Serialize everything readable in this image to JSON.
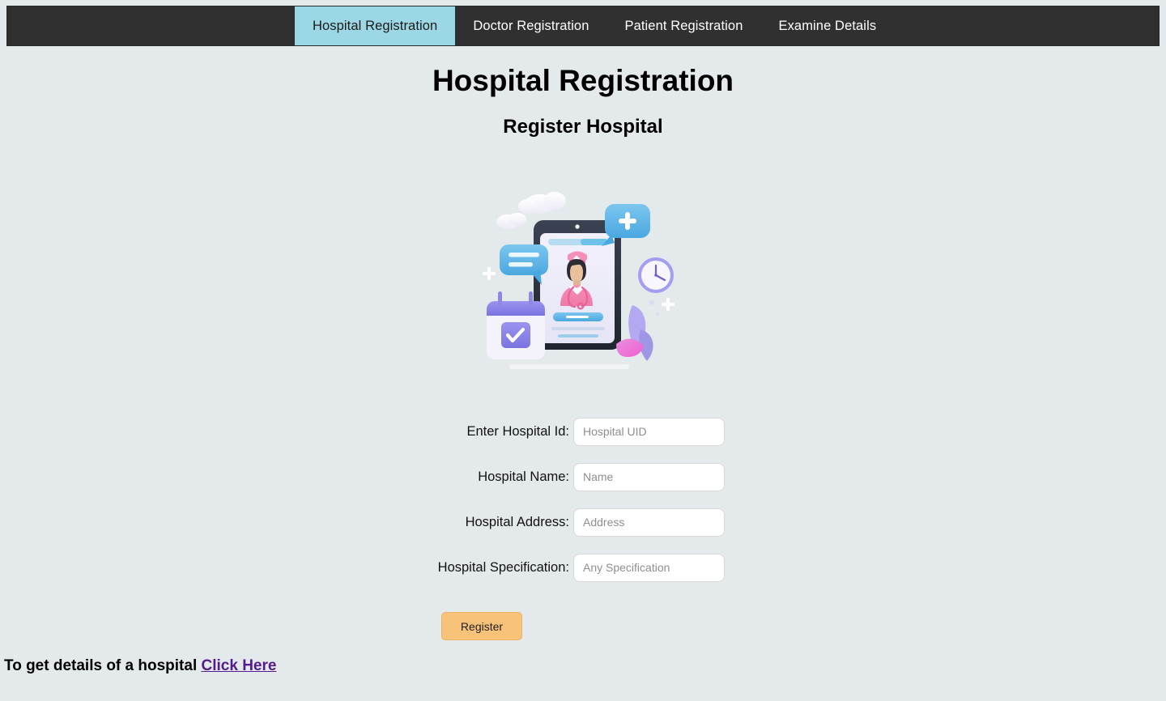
{
  "nav": {
    "tabs": [
      {
        "label": "Hospital Registration",
        "active": true
      },
      {
        "label": "Doctor Registration",
        "active": false
      },
      {
        "label": "Patient Registration",
        "active": false
      },
      {
        "label": "Examine Details",
        "active": false
      }
    ],
    "background_color": "#303030",
    "active_tab_color": "#9bd7e4"
  },
  "header": {
    "title": "Hospital Registration",
    "subtitle": "Register Hospital"
  },
  "illustration": {
    "name": "medical-appointment-illustration",
    "alt": "Tablet showing a nurse profile with chat bubbles, calendar and clock"
  },
  "form": {
    "fields": [
      {
        "label": "Enter Hospital Id:",
        "placeholder": "Hospital UID",
        "value": "",
        "name": "hospital-id-input"
      },
      {
        "label": "Hospital Name:",
        "placeholder": "Name",
        "value": "",
        "name": "hospital-name-input"
      },
      {
        "label": "Hospital Address:",
        "placeholder": "Address",
        "value": "",
        "name": "hospital-address-input"
      },
      {
        "label": "Hospital Specification:",
        "placeholder": "Any Specification",
        "value": "",
        "name": "hospital-specification-input"
      }
    ],
    "submit_label": "Register",
    "submit_color": "#f8c278"
  },
  "footer": {
    "text": "To get details of a hospital ",
    "link_label": "Click Here",
    "link_color": "#551a8b"
  },
  "page": {
    "background_color": "#e4e9ec"
  }
}
